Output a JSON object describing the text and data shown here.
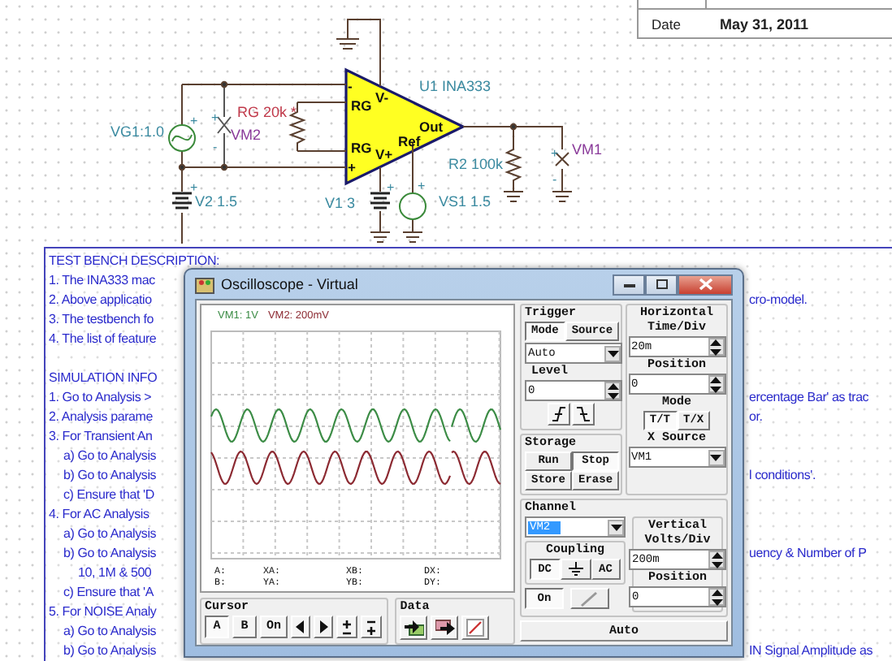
{
  "schematic": {
    "labels": [
      {
        "text": "U1 INA333",
        "kind": "part"
      },
      {
        "text": "RG 20k *",
        "kind": "gain"
      },
      {
        "text": "VG1:1.0",
        "kind": "part"
      },
      {
        "text": "VM2",
        "kind": "meter"
      },
      {
        "text": "R2 100k",
        "kind": "part"
      },
      {
        "text": "VM1",
        "kind": "meter"
      },
      {
        "text": "V2 1.5",
        "kind": "part"
      },
      {
        "text": "V1 3",
        "kind": "part"
      },
      {
        "text": "VS1 1.5",
        "kind": "part"
      },
      {
        "text": "-",
        "kind": "pin"
      },
      {
        "text": "RG",
        "kind": "pin"
      },
      {
        "text": "RG",
        "kind": "pin"
      },
      {
        "text": "+",
        "kind": "pin"
      },
      {
        "text": "V-",
        "kind": "pin"
      },
      {
        "text": "V+",
        "kind": "pin"
      },
      {
        "text": "Out",
        "kind": "pin"
      },
      {
        "text": "Ref",
        "kind": "pin"
      },
      {
        "text": "+",
        "kind": "polarity"
      },
      {
        "text": "+",
        "kind": "polarity"
      },
      {
        "text": "-",
        "kind": "polarity"
      },
      {
        "text": "+",
        "kind": "polarity"
      },
      {
        "text": "+",
        "kind": "polarity"
      },
      {
        "text": "+",
        "kind": "polarity"
      },
      {
        "text": "+",
        "kind": "polarity"
      },
      {
        "text": "-",
        "kind": "polarity"
      }
    ]
  },
  "info_table": {
    "label": "Date",
    "value": "May 31, 2011"
  },
  "description": {
    "sections": [
      {
        "heading": "TEST BENCH DESCRIPTION:",
        "items": [
          {
            "text": "1. The INA333 mac"
          },
          {
            "text": "2. Above applicatio",
            "tail": "cro-model."
          },
          {
            "text": "3. The testbench fo"
          },
          {
            "text": "4. The list of feature"
          }
        ]
      },
      {
        "heading": "SIMULATION INFO",
        "items": [
          {
            "text": "1. Go to Analysis >",
            "tail": "ercentage Bar' as trac"
          },
          {
            "text": "2. Analysis parame",
            "tail": "or."
          },
          {
            "text": "3. For Transient An",
            "children": [
              {
                "text": "a) Go to Analysis"
              },
              {
                "text": "b) Go to Analysis",
                "tail": "l conditions'."
              },
              {
                "text": "c) Ensure that 'D"
              }
            ]
          },
          {
            "text": "4. For AC  Analysis",
            "children": [
              {
                "text": "a) Go to Analysis"
              },
              {
                "text": "b) Go to Analysis",
                "tail": "uency & Number of P",
                "children": [
                  {
                    "text": "10, 1M & 500"
                  }
                ]
              },
              {
                "text": "c) Ensure that 'A"
              }
            ]
          },
          {
            "text": "5. For NOISE Analy",
            "children": [
              {
                "text": "a) Go to Analysis"
              },
              {
                "text": "b) Go to Analysis",
                "tail": "IN Signal Amplitude as"
              }
            ]
          }
        ]
      }
    ]
  },
  "oscilloscope": {
    "title": "Oscilloscope - Virtual",
    "channel_labels": [
      {
        "text": "VM1: 1V",
        "color": "#3c8c46"
      },
      {
        "text": "VM2: 200mV",
        "color": "#8c2a32"
      }
    ],
    "readouts": [
      "A:",
      "XA:",
      "XB:",
      "DX:",
      "B:",
      "YA:",
      "YB:",
      "DY:"
    ],
    "cursor": {
      "title": "Cursor",
      "buttons": [
        {
          "label": "A",
          "selected": true
        },
        {
          "label": "B",
          "selected": false
        },
        {
          "label": "On",
          "selected": false
        }
      ]
    },
    "data": {
      "title": "Data"
    },
    "trigger": {
      "title": "Trigger",
      "tabs": [
        {
          "label": "Mode",
          "selected": true
        },
        {
          "label": "Source",
          "selected": false
        }
      ],
      "mode_value": "Auto",
      "level_label": "Level",
      "level_value": "0"
    },
    "horizontal": {
      "title": "Horizontal",
      "time_div_label": "Time/Div",
      "time_div_value": "20m",
      "position_label": "Position",
      "position_value": "0",
      "mode_label": "Mode",
      "modes": [
        {
          "label": "T/T",
          "selected": true
        },
        {
          "label": "T/X",
          "selected": false
        }
      ],
      "x_source_label": "X Source",
      "x_source_value": "VM1"
    },
    "storage": {
      "title": "Storage",
      "buttons": [
        {
          "label": "Run",
          "selected": false
        },
        {
          "label": "Stop",
          "selected": true
        },
        {
          "label": "Store",
          "selected": false
        },
        {
          "label": "Erase",
          "selected": false
        }
      ]
    },
    "channel": {
      "title": "Channel",
      "value": "VM2",
      "coupling_title": "Coupling",
      "coupling": [
        {
          "kind": "text",
          "label": "DC",
          "selected": true
        },
        {
          "kind": "ground",
          "selected": false
        },
        {
          "kind": "text",
          "label": "AC",
          "selected": false
        }
      ],
      "on_button": {
        "label": "On",
        "selected": true
      }
    },
    "vertical": {
      "title": "Vertical",
      "volts_div_label": "Volts/Div",
      "volts_div_value": "200m",
      "position_label": "Position",
      "position_value": "0"
    },
    "auto_button": "Auto"
  }
}
